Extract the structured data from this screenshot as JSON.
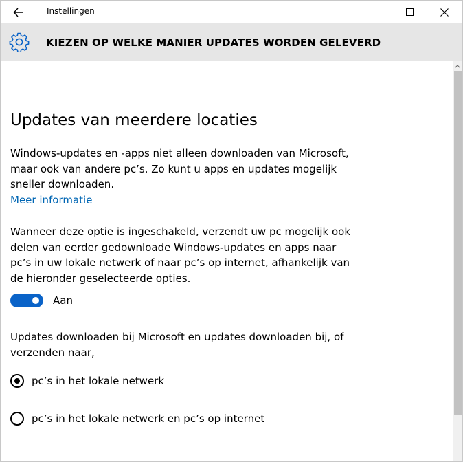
{
  "window": {
    "app_title": "Instellingen",
    "controls": {
      "minimize": "minimize-icon",
      "maximize": "maximize-icon",
      "close": "close-icon"
    }
  },
  "header": {
    "icon": "gear-icon",
    "title": "KIEZEN OP WELKE MANIER UPDATES WORDEN GELEVERD"
  },
  "main": {
    "heading": "Updates van meerdere locaties",
    "intro": "Windows-updates en -apps niet alleen downloaden van Microsoft, maar ook van andere pc’s. Zo kunt u apps en updates mogelijk sneller downloaden.",
    "more_info_link": "Meer informatie",
    "description": "Wanneer deze optie is ingeschakeld, verzendt uw pc mogelijk ook delen van eerder gedownloade Windows-updates en apps naar pc’s in uw lokale netwerk of naar pc’s op internet, afhankelijk van de hieronder geselecteerde opties.",
    "toggle": {
      "state": "on",
      "label": "Aan"
    },
    "options_prompt": "Updates downloaden bij Microsoft en updates downloaden bij, of verzenden naar,",
    "options": [
      {
        "label": "pc’s in het lokale netwerk",
        "selected": true
      },
      {
        "label": "pc’s in het lokale netwerk en pc’s op internet",
        "selected": false
      }
    ]
  },
  "colors": {
    "accent": "#0a63c8",
    "link": "#0066b4",
    "header_bg": "#e6e6e6"
  }
}
